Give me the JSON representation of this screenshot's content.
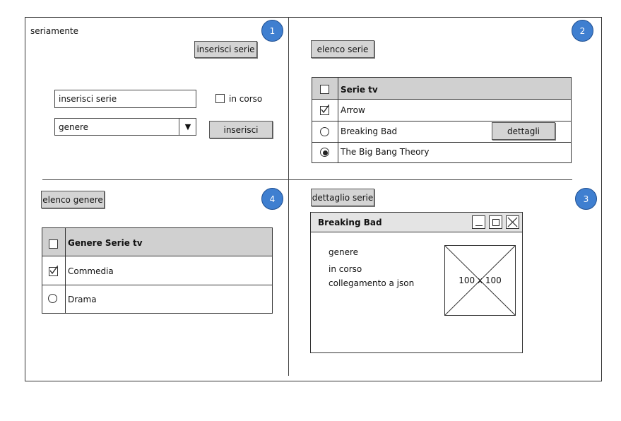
{
  "app_title": "seriamente",
  "badges": [
    "1",
    "2",
    "3",
    "4"
  ],
  "panel1": {
    "top_button": "inserisci serie",
    "input_placeholder": "inserisci serie",
    "checkbox_label": "in corso",
    "genre_select": "genere",
    "submit_button": "inserisci"
  },
  "panel2": {
    "title_button": "elenco serie",
    "table_header": "Serie tv",
    "rows": [
      "Arrow",
      "Breaking Bad",
      "The Big Bang Theory"
    ],
    "detail_button": "dettagli"
  },
  "panel3": {
    "title_button": "dettaglio serie",
    "window_title": "Breaking Bad",
    "fields": [
      "genere",
      "in corso",
      "collegamento a json"
    ],
    "image_placeholder": "100 x 100"
  },
  "panel4": {
    "title_button": "elenco genere",
    "table_header": "Genere Serie tv",
    "rows": [
      "Commedia",
      "Drama"
    ]
  }
}
